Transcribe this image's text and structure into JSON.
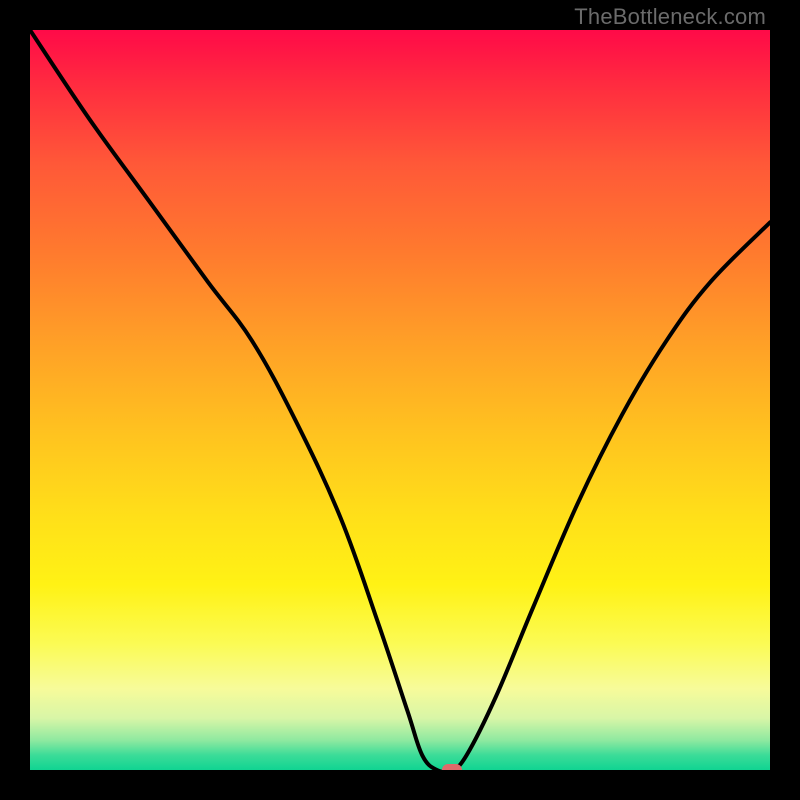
{
  "watermark": "TheBottleneck.com",
  "chart_data": {
    "type": "line",
    "title": "",
    "xlabel": "",
    "ylabel": "",
    "xlim": [
      0,
      100
    ],
    "ylim": [
      0,
      100
    ],
    "x": [
      0,
      8,
      16,
      24,
      30,
      36,
      42,
      47,
      51,
      53,
      55,
      57,
      59,
      63,
      68,
      74,
      80,
      86,
      92,
      100
    ],
    "values": [
      100,
      88,
      77,
      66,
      58,
      47,
      34,
      20,
      8,
      2,
      0,
      0,
      2,
      10,
      22,
      36,
      48,
      58,
      66,
      74
    ],
    "marker": {
      "x": 57,
      "y": 0
    },
    "background_gradient": {
      "top": "#ff0a48",
      "mid": "#ffe019",
      "bottom": "#10d492"
    }
  }
}
